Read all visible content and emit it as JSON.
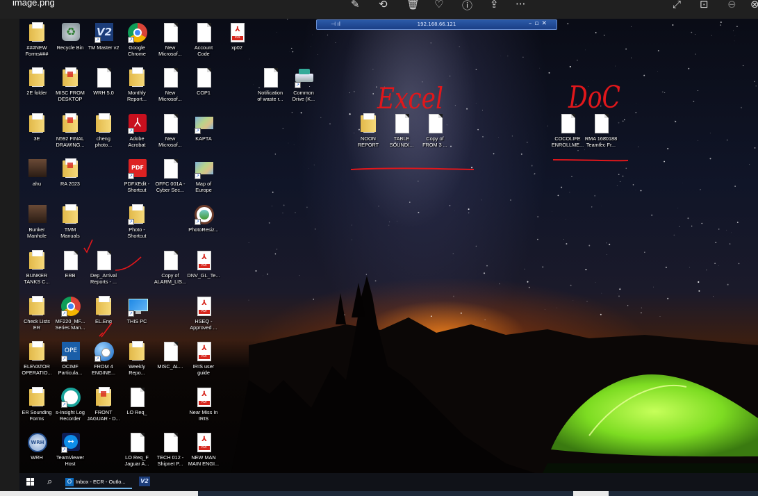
{
  "viewer": {
    "file_title": "image.png",
    "toolbar_icons": [
      "edit-image-icon",
      "rotate-icon",
      "delete-icon",
      "favorite-icon",
      "info-icon",
      "share-icon",
      "more-icon",
      "fullscreen-icon",
      "actual-size-icon",
      "zoom-icon",
      "close-icon"
    ]
  },
  "remote_session": {
    "host": "192.168.66.121"
  },
  "desktop": {
    "icons": [
      {
        "label": "###NEW\nForms###",
        "type": "folder"
      },
      {
        "label": "Recycle Bin",
        "type": "recycle"
      },
      {
        "label": "TM Master v2",
        "type": "v2"
      },
      {
        "label": "Google\nChrome",
        "type": "chrome"
      },
      {
        "label": "New\nMicrosof...",
        "type": "doc"
      },
      {
        "label": "Account\nCode",
        "type": "doc"
      },
      {
        "label": "xp02",
        "type": "pdf"
      },
      {
        "label": "2E folder",
        "type": "folder"
      },
      {
        "label": "MISC FROM\nDESKTOP",
        "type": "folder-pdf"
      },
      {
        "label": "WRH 5.0",
        "type": "doc"
      },
      {
        "label": "Monthly\nReport...",
        "type": "folder"
      },
      {
        "label": "New\nMicrosof...",
        "type": "doc"
      },
      {
        "label": "COP1",
        "type": "doc"
      },
      {
        "label": "Notification\nof waste r...",
        "type": "doc"
      },
      {
        "label": "Common\nDrive (K...",
        "type": "drive"
      },
      {
        "label": "3E",
        "type": "folder"
      },
      {
        "label": "N592 FINAL\nDRAWING...",
        "type": "folder-pdf"
      },
      {
        "label": "cheng\nphoto...",
        "type": "folder"
      },
      {
        "label": "Adobe\nAcrobat",
        "type": "acrobat"
      },
      {
        "label": "New\nMicrosof...",
        "type": "doc"
      },
      {
        "label": "KAPTA",
        "type": "map"
      },
      {
        "label": "ahu",
        "type": "photo"
      },
      {
        "label": "RA 2023",
        "type": "folder-pdf"
      },
      {
        "label": "PDFXEdit -\nShortcut",
        "type": "pdfx"
      },
      {
        "label": "OFFC 001A -\nCyber Sec...",
        "type": "doc"
      },
      {
        "label": "Map of\nEurope",
        "type": "map"
      },
      {
        "label": "Bunker\nManhole",
        "type": "photo"
      },
      {
        "label": "TMM\nManuals",
        "type": "folder"
      },
      {
        "label": "Photo -\nShortcut",
        "type": "folder"
      },
      {
        "label": "PhotoResiz...",
        "type": "resizer"
      },
      {
        "label": "BUNKER\nTANKS C...",
        "type": "folder"
      },
      {
        "label": "ERB",
        "type": "doc"
      },
      {
        "label": "Dep_Arrival\nReports - ...",
        "type": "doc"
      },
      {
        "label": "Copy of\nALARM_LIS...",
        "type": "doc"
      },
      {
        "label": "DNV_GL_Te...",
        "type": "pdf"
      },
      {
        "label": "Check Lists\nER",
        "type": "folder"
      },
      {
        "label": "MF220_MF...\nSeries Man...",
        "type": "chrome"
      },
      {
        "label": "EL.Eng",
        "type": "folder"
      },
      {
        "label": "THIS PC",
        "type": "thispc"
      },
      {
        "label": "HSEQ -\nApproved ...",
        "type": "pdf"
      },
      {
        "label": "ELEVATOR\nOPERATIO...",
        "type": "folder"
      },
      {
        "label": "OCIMF\nParticula...",
        "type": "ope"
      },
      {
        "label": "FROM 4\nENGINE...",
        "type": "globe"
      },
      {
        "label": "Weekly\nRepo...",
        "type": "folder"
      },
      {
        "label": "MISC_AL...",
        "type": "doc"
      },
      {
        "label": "IRIS user\nguide",
        "type": "pdf"
      },
      {
        "label": "ER Sounding\nForms",
        "type": "folder"
      },
      {
        "label": "s-Insight Log\nRecorder",
        "type": "sinsight"
      },
      {
        "label": "FRONT\nJAGUAR - D...",
        "type": "folder-pdf"
      },
      {
        "label": "LO Req_",
        "type": "doc"
      },
      {
        "label": "Near Miss In\nIRIS",
        "type": "pdf"
      },
      {
        "label": "WRH",
        "type": "wrh"
      },
      {
        "label": "TeamViewer\nHost",
        "type": "teamviewer"
      },
      {
        "label": "LO Req_F\nJaguar A...",
        "type": "doc"
      },
      {
        "label": "TECH 012 -\nShipnet P...",
        "type": "doc"
      },
      {
        "label": "NEW MAN\nMAIN ENGI...",
        "type": "pdf"
      },
      {
        "label": "NOON\nREPORT",
        "type": "folder"
      },
      {
        "label": "TABLE\nSOUNDI...",
        "type": "doc"
      },
      {
        "label": "Copy of\nFROM 3 ...",
        "type": "doc"
      },
      {
        "label": "COCOLIFE\nENROLLME...",
        "type": "doc"
      },
      {
        "label": "RMA 1680188\nTeamtec Fr...",
        "type": "doc"
      }
    ]
  },
  "annotations": {
    "excel_label": "Excel",
    "doc_label": "DoC",
    "marker_color": "#e0171b"
  },
  "taskbar": {
    "outlook_item": "Inbox - ECR - Outlo...",
    "v2_label": "V2"
  }
}
